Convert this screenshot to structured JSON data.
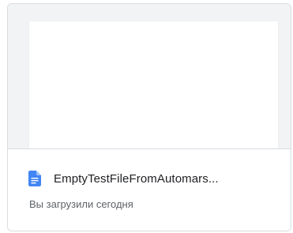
{
  "card": {
    "file_name": "EmptyTestFileFromAutomars...",
    "subtitle": "Вы загрузили сегодня",
    "file_type_icon": "google-docs-icon",
    "icon_color": "#4285f4"
  }
}
